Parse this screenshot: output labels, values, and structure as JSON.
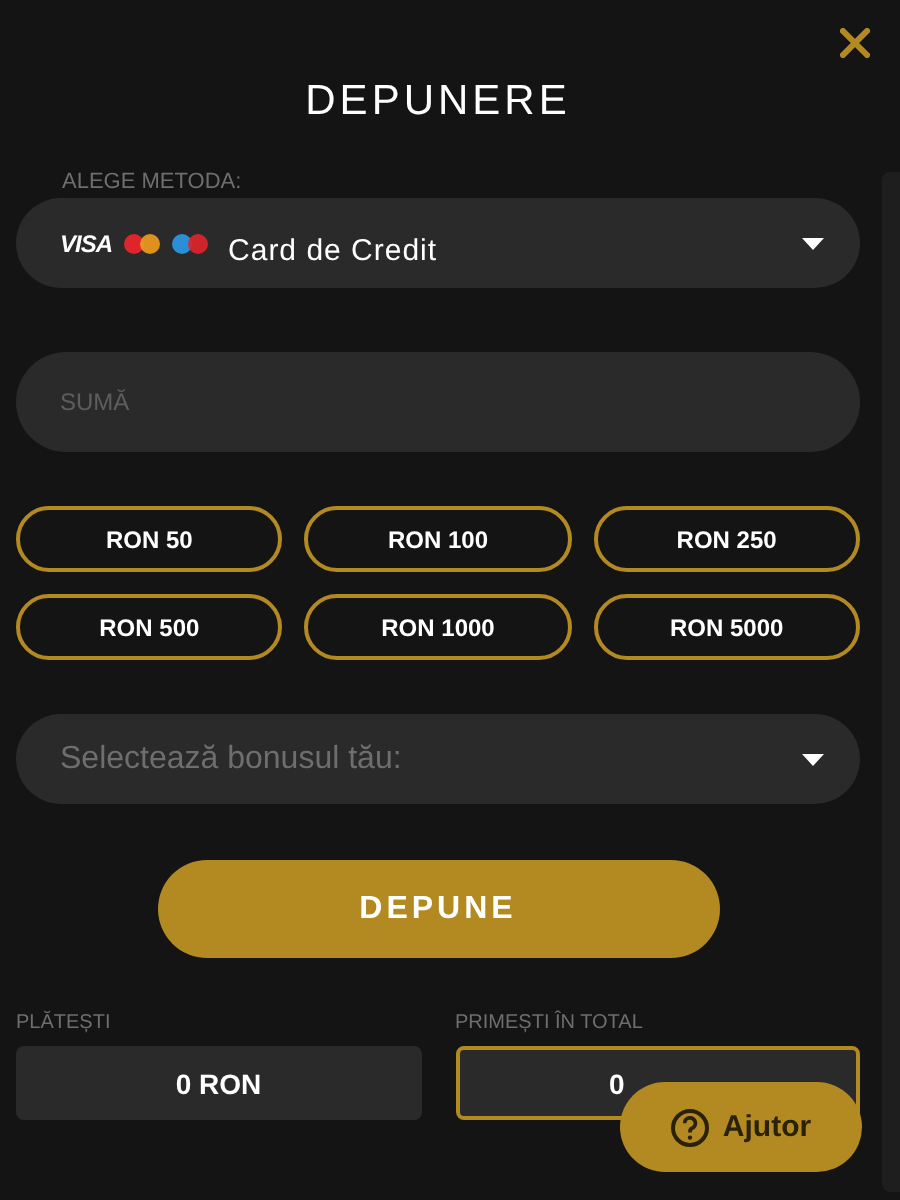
{
  "title": "DEPUNERE",
  "method": {
    "label": "ALEGE METODA:",
    "logo_text": "VISA",
    "value": "Card de Credit"
  },
  "amount": {
    "placeholder": "SUMĂ"
  },
  "presets": [
    {
      "label": "RON 50"
    },
    {
      "label": "RON 100"
    },
    {
      "label": "RON 250"
    },
    {
      "label": "RON 500"
    },
    {
      "label": "RON 1000"
    },
    {
      "label": "RON 5000"
    }
  ],
  "bonus": {
    "placeholder": "Selectează bonusul tău:"
  },
  "submit": "DEPUNE",
  "summary": [
    {
      "label": "PLĂTEȘTI",
      "value": "0 RON",
      "highlighted": false
    },
    {
      "label": "PRIMEȘTI ÎN TOTAL",
      "value": "0",
      "highlighted": true
    }
  ],
  "help": "Ajutor"
}
